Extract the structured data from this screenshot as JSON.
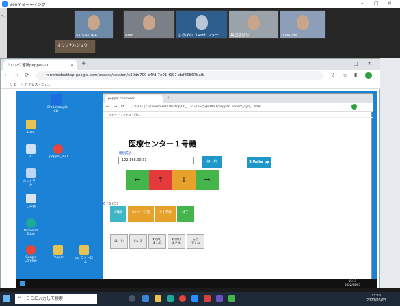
{
  "zoom": {
    "title": "Zoomミーティング",
    "participants": [
      "SK SAKURA",
      "aran",
      "ぷろぽの ３RMセンター",
      "集団活動法",
      "Isakiyos"
    ],
    "second_row_name": "オリジナルショウ"
  },
  "left_label": "C:",
  "chrome": {
    "tab_title": "ムロック遠隔pepper-01",
    "url": "remotedesktop.google.com/access/session/c30dd709-c4fd-7e01-f197-daf86867bafb",
    "bookmark": "リモート アクセス - Chr..."
  },
  "desktop": {
    "icons": [
      "Chromeapple CLI",
      "Luan",
      "PC",
      "pepper_mc1",
      "ネットワーク",
      "ごみ箱",
      "Microsoft Edge",
      "Google Chrome",
      "Pepper",
      "go_コントロール"
    ]
  },
  "inner": {
    "tab_title": "pepper controller",
    "url": "ファイル | C:/Users/user/Desktop/00_コントローラ/pk08c1/pepperConnect_ityo_1.html",
    "bookmark": "リモート アクセス - Chr...",
    "page_title": "医療センター１号機",
    "conn_status": "接続成功",
    "ip": "192.168.00.31",
    "connect_label": "接　続",
    "wake_label": "2.Wake up",
    "arrows": [
      "←",
      "↑",
      "↓",
      "→"
    ],
    "page_count": "6 / 5 (日)",
    "categories": [
      "①職食",
      "②メンドコ語",
      "②十字組",
      "終了"
    ],
    "answers": [
      "は　い",
      "いいえ",
      "わかり\nました",
      "わかり\nません",
      "そう\nですね"
    ]
  },
  "taskbar": {
    "search_placeholder": "ここに入力して検索",
    "time": "15:11",
    "date": "2022/06/03"
  },
  "inner_time": "15:11",
  "inner_date": "2022/06/03",
  "colors": {
    "red": "#e43a3c",
    "green": "#43b54a",
    "orange": "#e7a22b",
    "teal": "#1e97c9"
  }
}
